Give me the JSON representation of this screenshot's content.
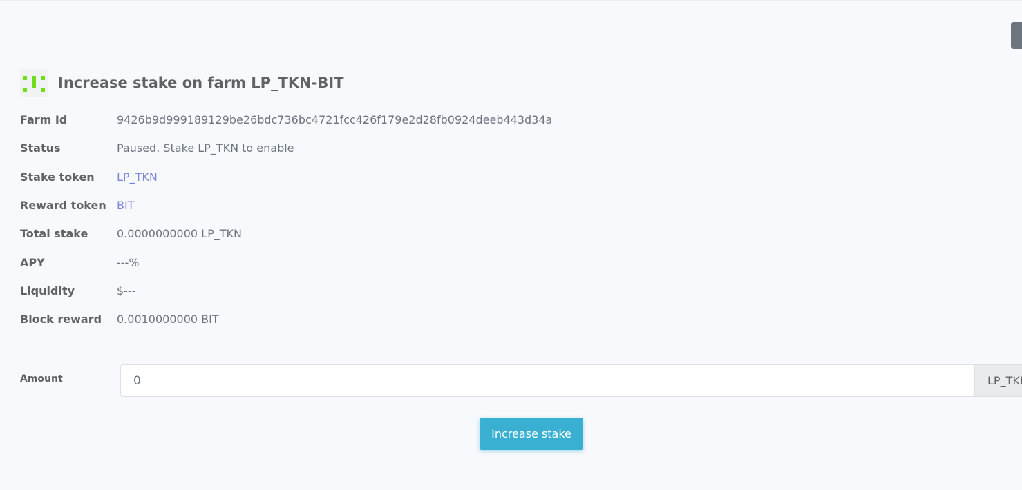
{
  "header": {
    "title": "Increase stake on farm LP_TKN-BIT",
    "icon": "token-identicon"
  },
  "farm": {
    "rows": [
      {
        "label": "Farm Id",
        "value": "9426b9d999189129be26bdc736bc4721fcc426f179e2d28fb0924deeb443d34a",
        "is_link": false
      },
      {
        "label": "Status",
        "value": "Paused. Stake LP_TKN to enable",
        "is_link": false
      },
      {
        "label": "Stake token",
        "value": "LP_TKN",
        "is_link": true
      },
      {
        "label": "Reward token",
        "value": "BIT",
        "is_link": true
      },
      {
        "label": "Total stake",
        "value": "0.0000000000 LP_TKN",
        "is_link": false
      },
      {
        "label": "APY",
        "value": "---%",
        "is_link": false
      },
      {
        "label": "Liquidity",
        "value": "$---",
        "is_link": false
      },
      {
        "label": "Block reward",
        "value": "0.0010000000 BIT",
        "is_link": false
      }
    ]
  },
  "form": {
    "amount_label": "Amount",
    "amount_value": "0",
    "amount_unit": "LP_TKN",
    "submit_label": "Increase stake"
  },
  "colors": {
    "accent": "#39afd1",
    "link": "#7a85d8",
    "icon_green": "#6fdc1c",
    "background": "#f8f9fd"
  }
}
